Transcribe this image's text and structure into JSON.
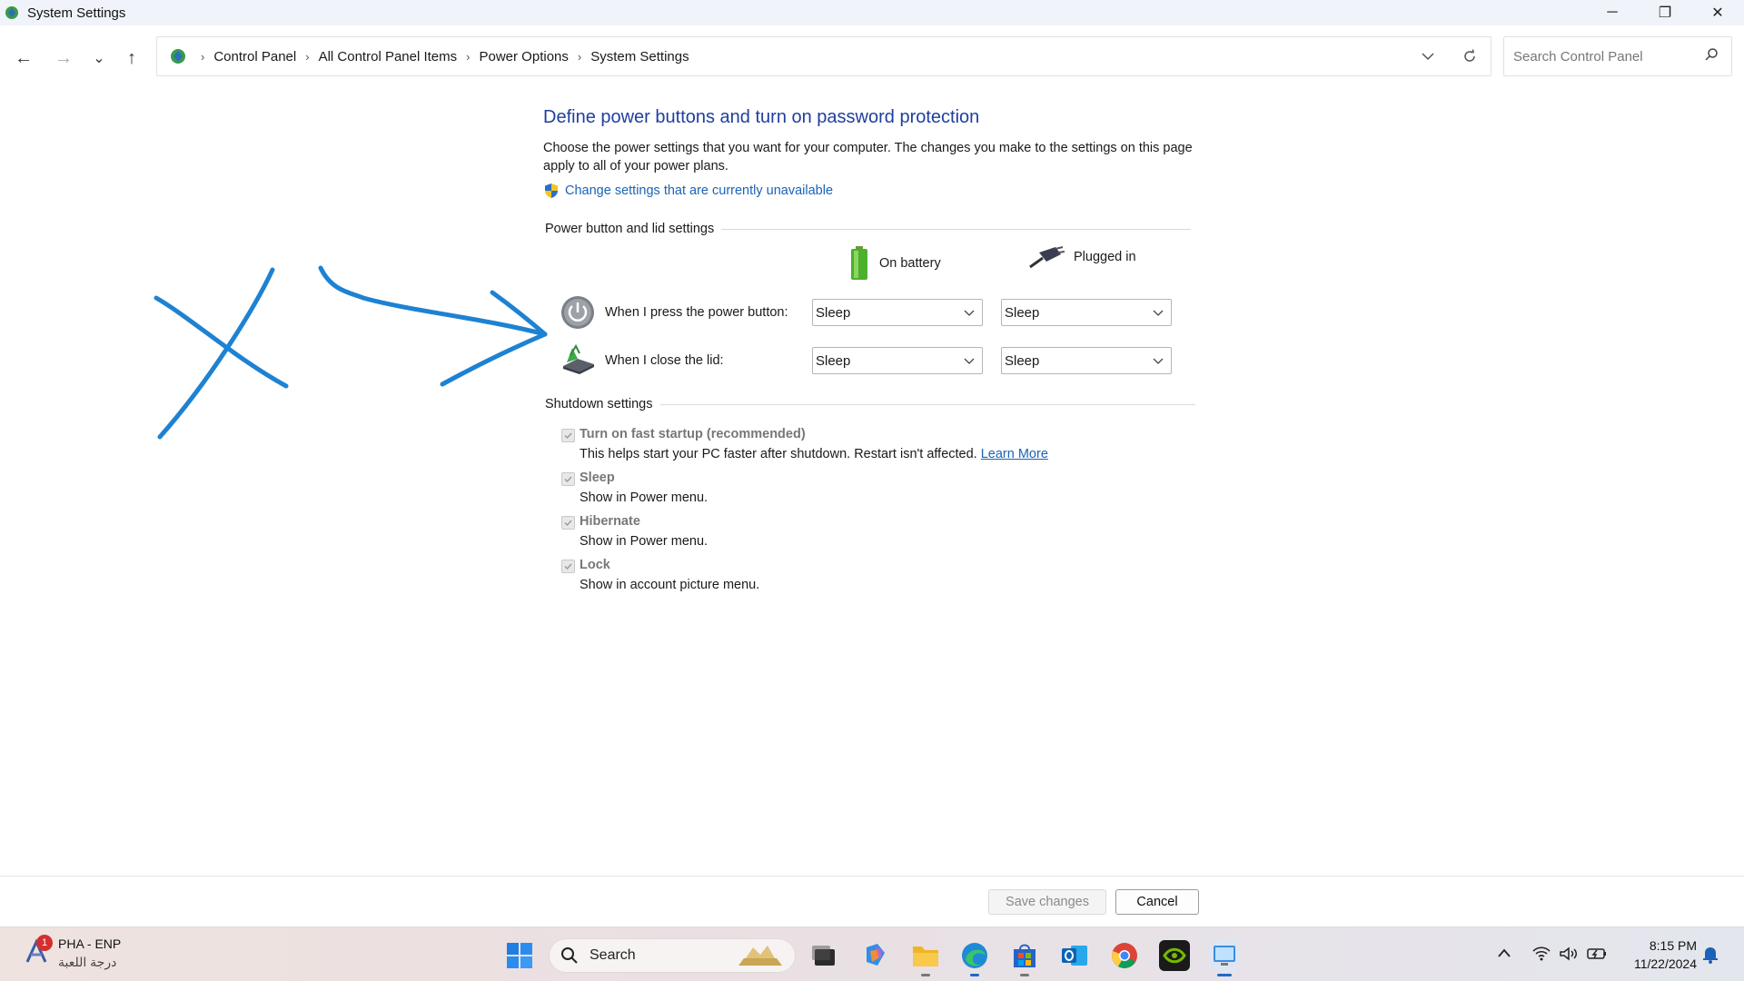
{
  "window": {
    "title": "System Settings",
    "minimize": "─",
    "maximize": "❐",
    "close": "✕"
  },
  "nav": {
    "back": "←",
    "forward": "→",
    "recent": "⌄",
    "up": "↑",
    "breadcrumbs": [
      "Control Panel",
      "All Control Panel Items",
      "Power Options",
      "System Settings"
    ],
    "separator": "›",
    "search_placeholder": "Search Control Panel"
  },
  "main": {
    "heading": "Define power buttons and turn on password protection",
    "description": "Choose the power settings that you want for your computer. The changes you make to the settings on this page apply to all of your power plans.",
    "change_link": "Change settings that are currently unavailable",
    "power_section": "Power button and lid settings",
    "col_battery": "On battery",
    "col_plugged": "Plugged in",
    "rows": [
      {
        "label": "When I press the power button:",
        "battery": "Sleep",
        "plugged": "Sleep"
      },
      {
        "label": "When I close the lid:",
        "battery": "Sleep",
        "plugged": "Sleep"
      }
    ],
    "shutdown_section": "Shutdown settings",
    "shutdown_items": [
      {
        "title": "Turn on fast startup (recommended)",
        "sub": "This helps start your PC faster after shutdown. Restart isn't affected.",
        "link": "Learn More",
        "checked": true
      },
      {
        "title": "Sleep",
        "sub": "Show in Power menu.",
        "checked": true
      },
      {
        "title": "Hibernate",
        "sub": "Show in Power menu.",
        "checked": true
      },
      {
        "title": "Lock",
        "sub": "Show in account picture menu.",
        "checked": true
      }
    ]
  },
  "footer": {
    "save": "Save changes",
    "cancel": "Cancel"
  },
  "taskbar": {
    "weather_title": "PHA - ENP",
    "weather_sub": "درجة اللعبة",
    "weather_badge": "1",
    "search_label": "Search",
    "time": "8:15 PM",
    "date": "11/22/2024"
  },
  "colors": {
    "heading": "#1f3f9e",
    "link": "#1a63b8",
    "annotation": "#1e82d2"
  }
}
